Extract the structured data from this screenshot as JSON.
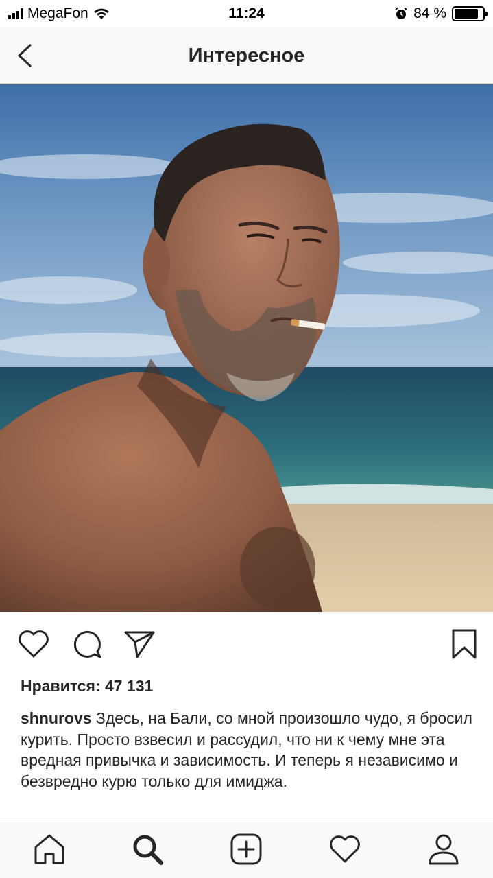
{
  "status_bar": {
    "carrier": "MegaFon",
    "time": "11:24",
    "battery_percent": "84 %",
    "battery_level": 0.84,
    "icons": [
      "signal-icon",
      "wifi-icon",
      "alarm-icon",
      "battery-icon"
    ]
  },
  "header": {
    "title": "Интересное",
    "back_icon": "chevron-left-icon"
  },
  "post": {
    "image_alt": "selfie-on-beach",
    "actions": [
      "heart-icon",
      "comment-icon",
      "share-icon",
      "bookmark-icon"
    ],
    "likes_text": "Нравится: 47 131",
    "username": "shnurovs",
    "caption": "Здесь, на Бали, со мной произошло чудо, я бросил курить. Просто взвесил и рассудил, что ни к чему мне эта вредная привычка и зависимость. И теперь я независимо и безвредно курю только для имиджа."
  },
  "tab_bar": {
    "items": [
      "home-icon",
      "search-icon",
      "add-post-icon",
      "activity-heart-icon",
      "profile-icon"
    ],
    "active": "search-icon"
  },
  "colors": {
    "text": "#262626",
    "bar_background": "#fafafa",
    "divider": "#dbdbdb"
  }
}
